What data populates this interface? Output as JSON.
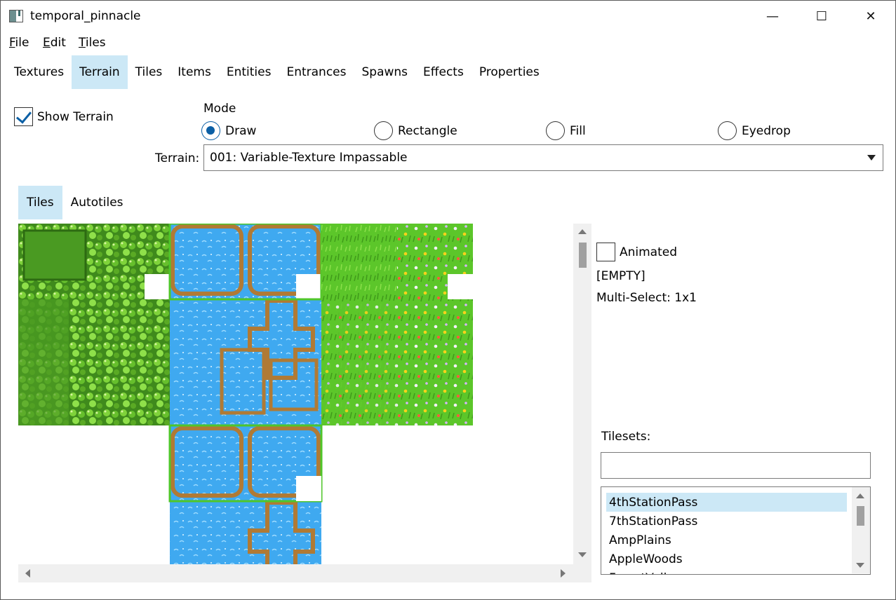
{
  "window": {
    "title": "temporal_pinnacle",
    "controls": {
      "minimize": "—",
      "maximize": "☐",
      "close": "✕"
    }
  },
  "menubar": {
    "items": [
      {
        "mnemonic": "F",
        "rest": "ile"
      },
      {
        "mnemonic": "E",
        "rest": "dit"
      },
      {
        "mnemonic": "T",
        "rest": "iles"
      }
    ]
  },
  "tabs": {
    "items": [
      "Textures",
      "Terrain",
      "Tiles",
      "Items",
      "Entities",
      "Entrances",
      "Spawns",
      "Effects",
      "Properties"
    ],
    "active": "Terrain"
  },
  "terrain_panel": {
    "show_terrain_label": "Show Terrain",
    "show_terrain_checked": true,
    "mode_label": "Mode",
    "modes": [
      "Draw",
      "Rectangle",
      "Fill",
      "Eyedrop"
    ],
    "selected_mode": "Draw",
    "terrain_label": "Terrain:",
    "terrain_value": "001: Variable-Texture Impassable"
  },
  "subtabs": {
    "items": [
      "Tiles",
      "Autotiles"
    ],
    "active": "Tiles"
  },
  "side_panel": {
    "animated_label": "Animated",
    "animated_checked": false,
    "selected_tile": "[EMPTY]",
    "multi_select": "Multi-Select: 1x1",
    "tilesets_label": "Tilesets:",
    "search_value": "",
    "tilesets": [
      "4thStationPass",
      "7thStationPass",
      "AmpPlains",
      "AppleWoods",
      "ForestValley"
    ],
    "selected_tileset": "4thStationPass"
  },
  "colors": {
    "accent": "#0b5fa5",
    "tab_active": "#cce8f6",
    "bush_dark": "#3f8a1c",
    "bush_light": "#7fd33a",
    "water": "#3fa9f0",
    "water_edge": "#b07a35",
    "grass": "#5cc62a"
  }
}
